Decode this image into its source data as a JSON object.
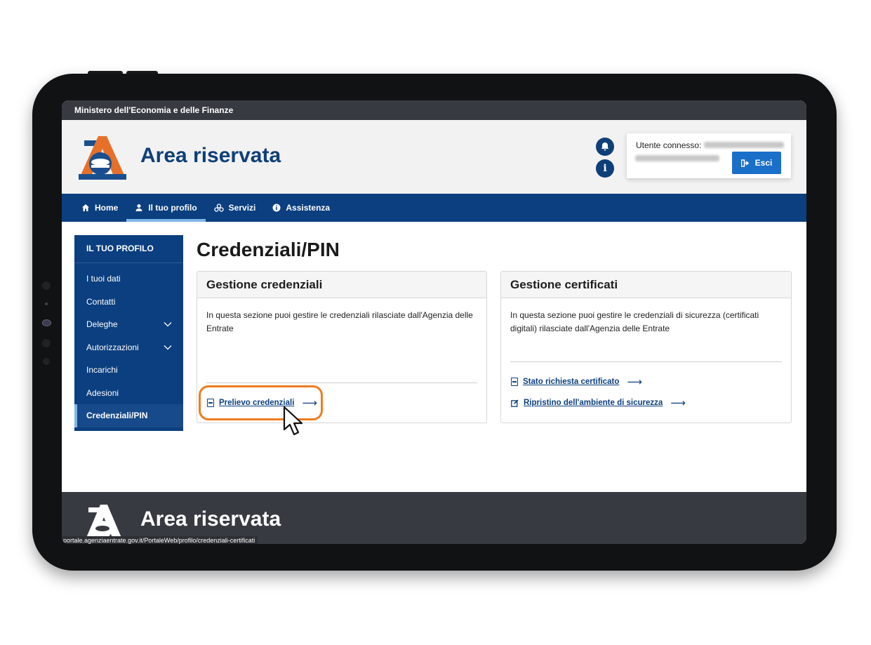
{
  "ministry_bar": {
    "text": "Ministero dell'Economia e delle Finanze"
  },
  "header": {
    "title": "Area riservata",
    "user_label": "Utente connesso:",
    "logout_label": "Esci",
    "notification_icon": "bell-icon",
    "info_icon": "info-icon"
  },
  "nav": {
    "items": [
      {
        "label": "Home",
        "icon": "home-icon"
      },
      {
        "label": "Il tuo profilo",
        "icon": "user-icon",
        "active": true
      },
      {
        "label": "Servizi",
        "icon": "services-icon"
      },
      {
        "label": "Assistenza",
        "icon": "info-icon"
      }
    ]
  },
  "sidebar": {
    "heading": "IL TUO PROFILO",
    "items": [
      {
        "label": "I tuoi dati"
      },
      {
        "label": "Contatti"
      },
      {
        "label": "Deleghe",
        "expandable": true
      },
      {
        "label": "Autorizzazioni",
        "expandable": true
      },
      {
        "label": "Incarichi"
      },
      {
        "label": "Adesioni"
      },
      {
        "label": "Credenziali/PIN",
        "active": true
      }
    ]
  },
  "main": {
    "title": "Credenziali/PIN",
    "cards": [
      {
        "title": "Gestione credenziali",
        "text": "In questa sezione puoi gestire le credenziali rilasciate dall'Agenzia delle Entrate",
        "links": [
          {
            "label": "Prelievo credenziali",
            "icon": "document-icon"
          }
        ]
      },
      {
        "title": "Gestione certificati",
        "text": "In questa sezione puoi gestire le credenziali di sicurezza (certificati digitali) rilasciate dall'Agenzia delle Entrate",
        "links": [
          {
            "label": "Stato richiesta certificato",
            "icon": "document-icon"
          },
          {
            "label": "Ripristino dell'ambiente di sicurezza",
            "icon": "edit-icon"
          }
        ]
      }
    ]
  },
  "footer": {
    "title": "Area riservata"
  },
  "status_bar": {
    "url": "portale.agenziaentrate.gov.it/PortaleWeb/profilo/credenziali-certificati"
  },
  "colors": {
    "brand_blue": "#0b3f7f",
    "accent_orange": "#ee7c1f",
    "button_blue": "#1a6fc9"
  }
}
